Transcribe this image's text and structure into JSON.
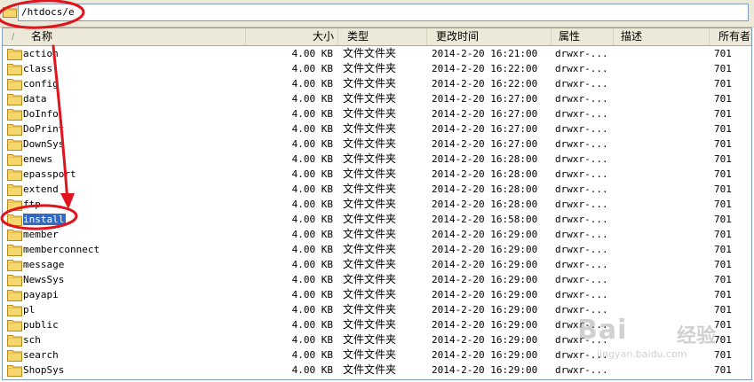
{
  "path_bar": {
    "value": "/htdocs/e"
  },
  "columns": {
    "sort_indicator": "/",
    "name": "名称",
    "size": "大小",
    "type": "类型",
    "modified": "更改时间",
    "attributes": "属性",
    "description": "描述",
    "owner": "所有者"
  },
  "files": [
    {
      "name": "action",
      "size": "4.00 KB",
      "type": "文件文件夹",
      "modified": "2014-2-20 16:21:00",
      "attributes": "drwxr-...",
      "owner": "701"
    },
    {
      "name": "class",
      "size": "4.00 KB",
      "type": "文件文件夹",
      "modified": "2014-2-20 16:22:00",
      "attributes": "drwxr-...",
      "owner": "701"
    },
    {
      "name": "config",
      "size": "4.00 KB",
      "type": "文件文件夹",
      "modified": "2014-2-20 16:22:00",
      "attributes": "drwxr-...",
      "owner": "701"
    },
    {
      "name": "data",
      "size": "4.00 KB",
      "type": "文件文件夹",
      "modified": "2014-2-20 16:27:00",
      "attributes": "drwxr-...",
      "owner": "701"
    },
    {
      "name": "DoInfo",
      "size": "4.00 KB",
      "type": "文件文件夹",
      "modified": "2014-2-20 16:27:00",
      "attributes": "drwxr-...",
      "owner": "701"
    },
    {
      "name": "DoPrint",
      "size": "4.00 KB",
      "type": "文件文件夹",
      "modified": "2014-2-20 16:27:00",
      "attributes": "drwxr-...",
      "owner": "701"
    },
    {
      "name": "DownSys",
      "size": "4.00 KB",
      "type": "文件文件夹",
      "modified": "2014-2-20 16:27:00",
      "attributes": "drwxr-...",
      "owner": "701"
    },
    {
      "name": "enews",
      "size": "4.00 KB",
      "type": "文件文件夹",
      "modified": "2014-2-20 16:28:00",
      "attributes": "drwxr-...",
      "owner": "701"
    },
    {
      "name": "epassport",
      "size": "4.00 KB",
      "type": "文件文件夹",
      "modified": "2014-2-20 16:28:00",
      "attributes": "drwxr-...",
      "owner": "701"
    },
    {
      "name": "extend",
      "size": "4.00 KB",
      "type": "文件文件夹",
      "modified": "2014-2-20 16:28:00",
      "attributes": "drwxr-...",
      "owner": "701"
    },
    {
      "name": "ftp",
      "size": "4.00 KB",
      "type": "文件文件夹",
      "modified": "2014-2-20 16:28:00",
      "attributes": "drwxr-...",
      "owner": "701"
    },
    {
      "name": "install",
      "size": "4.00 KB",
      "type": "文件文件夹",
      "modified": "2014-2-20 16:58:00",
      "attributes": "drwxr-...",
      "owner": "701",
      "selected": true
    },
    {
      "name": "member",
      "size": "4.00 KB",
      "type": "文件文件夹",
      "modified": "2014-2-20 16:29:00",
      "attributes": "drwxr-...",
      "owner": "701"
    },
    {
      "name": "memberconnect",
      "size": "4.00 KB",
      "type": "文件文件夹",
      "modified": "2014-2-20 16:29:00",
      "attributes": "drwxr-...",
      "owner": "701"
    },
    {
      "name": "message",
      "size": "4.00 KB",
      "type": "文件文件夹",
      "modified": "2014-2-20 16:29:00",
      "attributes": "drwxr-...",
      "owner": "701"
    },
    {
      "name": "NewsSys",
      "size": "4.00 KB",
      "type": "文件文件夹",
      "modified": "2014-2-20 16:29:00",
      "attributes": "drwxr-...",
      "owner": "701"
    },
    {
      "name": "payapi",
      "size": "4.00 KB",
      "type": "文件文件夹",
      "modified": "2014-2-20 16:29:00",
      "attributes": "drwxr-...",
      "owner": "701"
    },
    {
      "name": "pl",
      "size": "4.00 KB",
      "type": "文件文件夹",
      "modified": "2014-2-20 16:29:00",
      "attributes": "drwxr-...",
      "owner": "701"
    },
    {
      "name": "public",
      "size": "4.00 KB",
      "type": "文件文件夹",
      "modified": "2014-2-20 16:29:00",
      "attributes": "drwxr-...",
      "owner": "701"
    },
    {
      "name": "sch",
      "size": "4.00 KB",
      "type": "文件文件夹",
      "modified": "2014-2-20 16:29:00",
      "attributes": "drwxr-...",
      "owner": "701"
    },
    {
      "name": "search",
      "size": "4.00 KB",
      "type": "文件文件夹",
      "modified": "2014-2-20 16:29:00",
      "attributes": "drwxr-...",
      "owner": "701"
    },
    {
      "name": "ShopSys",
      "size": "4.00 KB",
      "type": "文件文件夹",
      "modified": "2014-2-20 16:29:00",
      "attributes": "drwxr-...",
      "owner": "701"
    }
  ],
  "icons": {
    "path_icon": "folder-icon",
    "row_icon": "folder-icon"
  },
  "colors": {
    "selection": "#316ac5",
    "folder_fill": "#f5d76e",
    "annotation_red": "#e0141e",
    "header_bg": "#ece9d8"
  },
  "watermark": {
    "logo": "Bai",
    "logo_cn": "经验",
    "url": "jingyan.baidu.com"
  }
}
